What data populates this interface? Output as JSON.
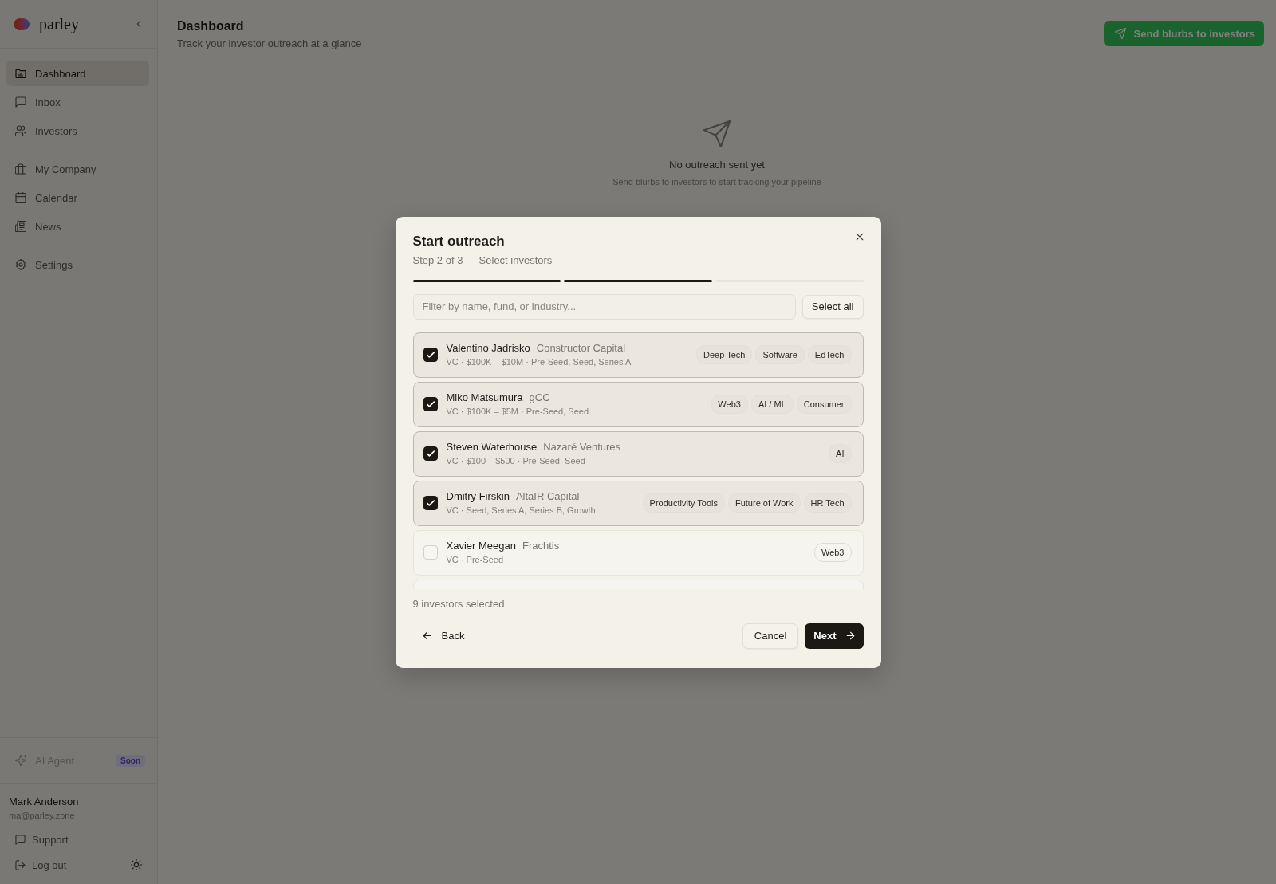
{
  "sidebar": {
    "brand": "parley",
    "nav_groups": [
      [
        {
          "label": "Dashboard",
          "selected": true
        },
        {
          "label": "Inbox",
          "selected": false
        },
        {
          "label": "Investors",
          "selected": false
        }
      ],
      [
        {
          "label": "My Company",
          "selected": false
        },
        {
          "label": "Calendar",
          "selected": false
        },
        {
          "label": "News",
          "selected": false
        }
      ],
      [
        {
          "label": "Settings",
          "selected": false
        }
      ]
    ],
    "agent": {
      "label": "AI Agent",
      "badge": "Soon",
      "disabled": true
    },
    "user": {
      "name": "Mark Anderson",
      "email": "ma@parley.zone"
    },
    "links": [
      "Support",
      "Log out"
    ]
  },
  "header": {
    "title": "Dashboard",
    "subtitle": "Track your investor outreach at a glance",
    "action": "Send blurbs to investors"
  },
  "empty_state": {
    "title": "No outreach sent yet",
    "text": "Send blurbs to investors to start tracking your pipeline"
  },
  "modal": {
    "title": "Start outreach",
    "subtitle": "Step 2 of 3 — Select investors",
    "steps": [
      {
        "filled": true
      },
      {
        "filled": true
      },
      {
        "filled": false
      }
    ],
    "filter": {
      "placeholder": "Filter by name, fund, or industry..."
    },
    "select_all": "Select all",
    "investors": [
      {
        "name": "Valentino Jadrisko",
        "fund": "Constructor Capital",
        "details": "VC · $100K – $10M · Pre-Seed, Seed, Series A",
        "tags": [
          "Deep Tech",
          "Software",
          "EdTech"
        ],
        "selected": true
      },
      {
        "name": "Miko Matsumura",
        "fund": "gCC",
        "details": "VC · $100K – $5M · Pre-Seed, Seed",
        "tags": [
          "Web3",
          "AI / ML",
          "Consumer"
        ],
        "selected": true
      },
      {
        "name": "Steven Waterhouse",
        "fund": "Nazaré Ventures",
        "details": "VC · $100 – $500 · Pre-Seed, Seed",
        "tags": [
          "AI"
        ],
        "selected": true
      },
      {
        "name": "Dmitry Firskin",
        "fund": "AltaIR Capital",
        "details": "VC · Seed, Series A, Series B, Growth",
        "tags": [
          "Productivity Tools",
          "Future of Work",
          "HR Tech"
        ],
        "selected": true
      },
      {
        "name": "Xavier Meegan",
        "fund": "Frachtis",
        "details": "VC · Pre-Seed",
        "tags": [
          "Web3"
        ],
        "selected": false
      }
    ],
    "count": "9 investors selected",
    "back": "Back",
    "cancel": "Cancel",
    "next": "Next"
  }
}
